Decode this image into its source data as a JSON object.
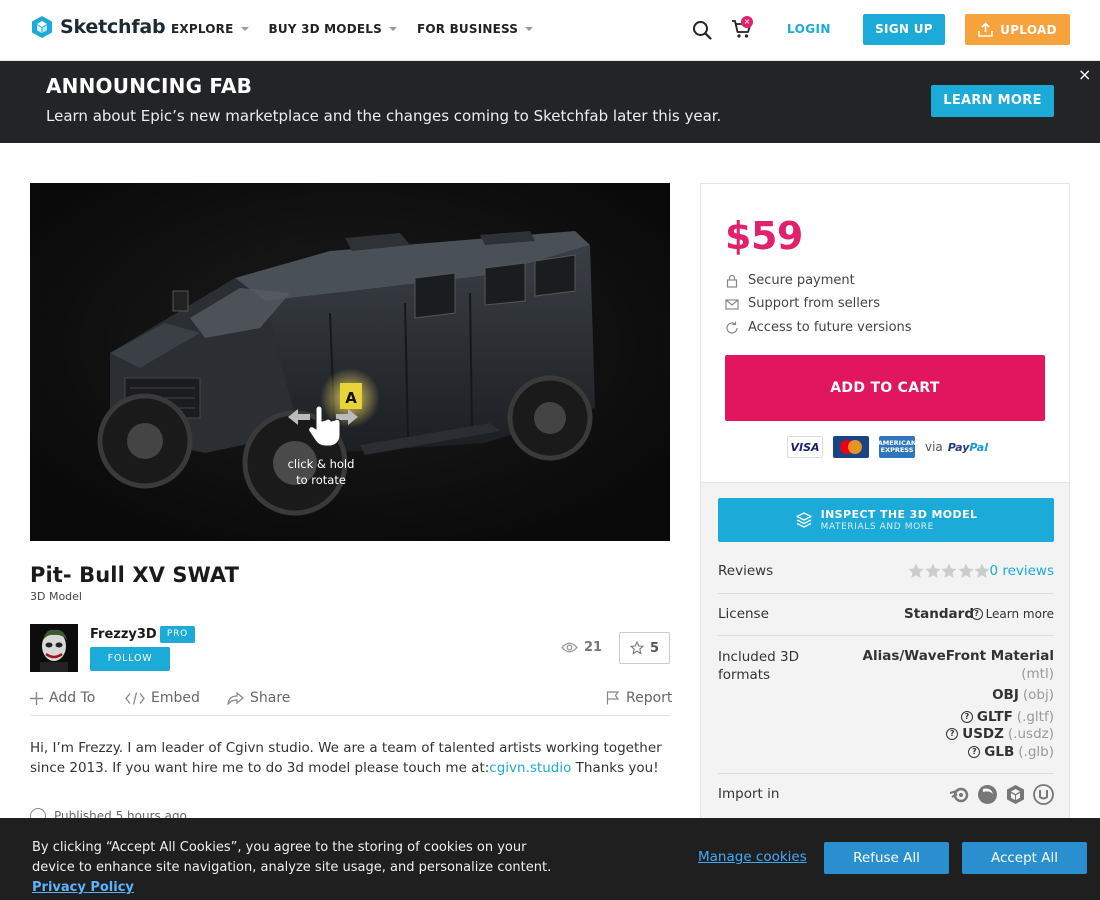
{
  "header": {
    "logo_text": "Sketchfab",
    "nav": [
      {
        "label": "EXPLORE"
      },
      {
        "label": "BUY 3D MODELS"
      },
      {
        "label": "FOR BUSINESS"
      }
    ],
    "cart_badge": "×",
    "login": "LOGIN",
    "signup": "SIGN UP",
    "upload": "UPLOAD"
  },
  "banner": {
    "title": "ANNOUNCING FAB",
    "text": "Learn about Epic’s new marketplace and the changes coming to Sketchfab later this year.",
    "button": "LEARN MORE",
    "close": "×"
  },
  "viewer": {
    "hint_line1": "click & hold",
    "hint_line2": "to rotate"
  },
  "model": {
    "title": "Pit- Bull XV SWAT",
    "type": "3D Model",
    "author": "Frezzy3D",
    "author_badge": "PRO",
    "follow": "FOLLOW",
    "views": "21",
    "likes": "5",
    "actions": {
      "add_to": "Add To",
      "embed": "Embed",
      "share": "Share",
      "report": "Report"
    },
    "description": "Hi, I’m Frezzy. I am leader of Cgivn studio. We are a team of talented artists working together since 2013. If you want hire me to do 3d model please touch me at:",
    "description_link": "cgivn.studio",
    "description_end": " Thanks you!",
    "published": "Published 5 hours ago"
  },
  "purchase": {
    "price": "$59",
    "perks": [
      "Secure payment",
      "Support from sellers",
      "Access to future versions"
    ],
    "add_to_cart": "ADD TO CART",
    "payment_visa": "VISA",
    "payment_amex": "AMERICAN EXPRESS",
    "payment_via": "via",
    "payment_paypal_a": "Pay",
    "payment_paypal_b": "Pal"
  },
  "info": {
    "inspect_title": "INSPECT THE 3D MODEL",
    "inspect_sub": "MATERIALS AND MORE",
    "reviews_label": "Reviews",
    "reviews_link": "0 reviews",
    "license_label": "License",
    "license_value": "Standard",
    "learn_more": "Learn more",
    "formats_label": "Included 3D formats",
    "formats": [
      {
        "name": "Alias/WaveFront Material",
        "ext": "(mtl)"
      },
      {
        "name": "OBJ",
        "ext": "(obj)"
      },
      {
        "name": "GLTF",
        "ext": "(.gltf)"
      },
      {
        "name": "USDZ",
        "ext": "(.usdz)"
      },
      {
        "name": "GLB",
        "ext": "(.glb)"
      }
    ],
    "import_label": "Import in"
  },
  "cookie": {
    "text": "By clicking “Accept All Cookies”, you agree to the storing of cookies on your device to enhance site navigation, analyze site usage, and personalize content.",
    "policy": "Privacy Policy",
    "manage": "Manage cookies",
    "refuse": "Refuse All",
    "accept": "Accept All"
  },
  "colors": {
    "accent_blue": "#1caad9",
    "price_pink": "#e1216b",
    "upload_orange": "#f6a33d"
  }
}
